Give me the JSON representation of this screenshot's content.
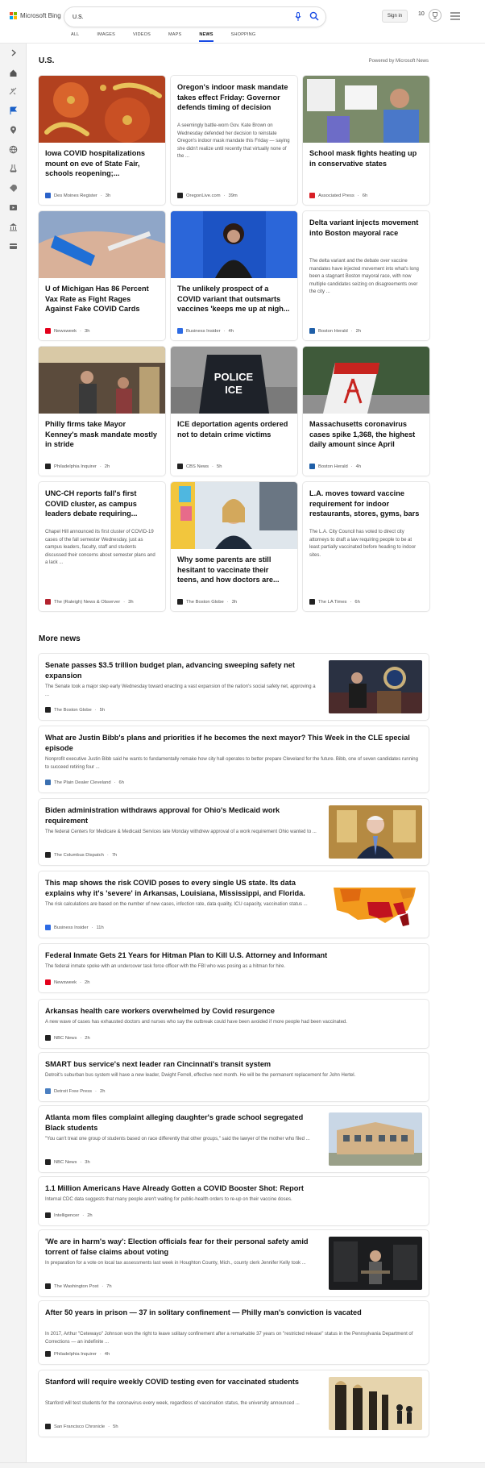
{
  "header": {
    "brand": "Microsoft Bing",
    "search_value": "U.S.",
    "signin_label": "Sign in",
    "points": "10",
    "tabs": [
      {
        "label": "ALL",
        "active": false
      },
      {
        "label": "IMAGES",
        "active": false
      },
      {
        "label": "VIDEOS",
        "active": false
      },
      {
        "label": "MAPS",
        "active": false
      },
      {
        "label": "NEWS",
        "active": true
      },
      {
        "label": "SHOPPING",
        "active": false
      }
    ]
  },
  "sidebar": {
    "icons": [
      "expand-icon",
      "home-icon",
      "discover-icon",
      "flag-icon",
      "location-pin-icon",
      "globe-icon",
      "science-icon",
      "rocket-icon",
      "entertainment-icon",
      "bank-icon",
      "card-icon"
    ]
  },
  "section": {
    "title": "U.S.",
    "powered_by": "Powered by Microsoft News"
  },
  "cards": [
    {
      "headline": "Iowa COVID hospitalizations mount on eve of State Fair, schools reopening;...",
      "snippet": "",
      "source": "Des Moines Register",
      "age": "3h",
      "image": "virus-image",
      "fav_color": "#2a62c9"
    },
    {
      "headline": "Oregon's indoor mask mandate takes effect Friday: Governor defends timing of decision",
      "snippet": "A seemingly battle-worn Gov. Kate Brown on Wednesday defended her decision to reinstate Oregon's indoor mask mandate this Friday — saying she didn't realize until recently that virtually none of the ...",
      "source": "OregonLive.com",
      "age": "39m",
      "image": "",
      "fav_color": "#222222"
    },
    {
      "headline": "School mask fights heating up in conservative states",
      "snippet": "",
      "source": "Associated Press",
      "age": "6h",
      "image": "protest-image",
      "fav_color": "#d81f26"
    },
    {
      "headline": "U of Michigan Has 86 Percent Vax Rate as Fight Rages Against Fake COVID Cards",
      "snippet": "",
      "source": "Newsweek",
      "age": "3h",
      "image": "vaccine-shot-image",
      "fav_color": "#e3001b"
    },
    {
      "headline": "The unlikely prospect of a COVID variant that outsmarts vaccines 'keeps me up at nigh...",
      "snippet": "",
      "source": "Business Insider",
      "age": "4h",
      "image": "press-briefing-image",
      "fav_color": "#2d6be4"
    },
    {
      "headline": "Delta variant injects movement into Boston mayoral race",
      "snippet": "The delta variant and the debate over vaccine mandates have injected movement into what's long been a stagnant Boston mayoral race, with now multiple candidates seizing on disagreements over the city ...",
      "source": "Boston Herald",
      "age": "2h",
      "image": "",
      "fav_color": "#1f5fa8"
    },
    {
      "headline": "Philly firms take Mayor Kenney's mask mandate mostly in stride",
      "snippet": "",
      "source": "Philadelphia Inquirer",
      "age": "2h",
      "image": "market-image",
      "fav_color": "#222222"
    },
    {
      "headline": "ICE deportation agents ordered not to detain crime victims",
      "snippet": "",
      "source": "CBS News",
      "age": "5h",
      "image": "police-ice-image",
      "fav_color": "#222222"
    },
    {
      "headline": "Massachusetts coronavirus cases spike 1,368, the highest daily amount since April",
      "snippet": "",
      "source": "Boston Herald",
      "age": "4h",
      "image": "vaccination-site-image",
      "fav_color": "#1f5fa8"
    },
    {
      "headline": "UNC-CH reports fall's first COVID cluster, as campus leaders debate requiring...",
      "snippet": "Chapel Hill announced its first cluster of COVID-19 cases of the fall semester Wednesday, just as campus leaders, faculty, staff and students discussed their concerns about semester plans and a lack ...",
      "source": "The (Raleigh) News & Observer",
      "age": "3h",
      "image": "",
      "fav_color": "#b3232e"
    },
    {
      "headline": "Why some parents are still hesitant to vaccinate their teens, and how doctors are...",
      "snippet": "",
      "source": "The Boston Globe",
      "age": "3h",
      "image": "doctor-image",
      "fav_color": "#222222"
    },
    {
      "headline": "L.A. moves toward vaccine requirement for indoor restaurants, stores, gyms, bars",
      "snippet": "The L.A. City Council has voted to direct city attorneys to draft a law requiring people to be at least partially vaccinated before heading to indoor sites.",
      "source": "The LA Times",
      "age": "6h",
      "image": "",
      "fav_color": "#222222"
    }
  ],
  "more_news": {
    "title": "More news",
    "items": [
      {
        "headline": "Senate passes $3.5 trillion budget plan, advancing sweeping safety net expansion",
        "snippet": "The Senate took a major step early Wednesday toward enacting a vast expansion of the nation's social safety net, approving a ...",
        "source": "The Boston Globe",
        "age": "5h",
        "thumb": "senate-image",
        "fav_color": "#222222"
      },
      {
        "headline": "What are Justin Bibb's plans and priorities if he becomes the next mayor? This Week in the CLE special episode",
        "snippet": "Nonprofit executive Justin Bibb said he wants to fundamentally remake how city hall operates to better prepare Cleveland for the future. Bibb, one of seven candidates running to succeed retiring four ...",
        "source": "The Plain Dealer Cleveland",
        "age": "6h",
        "thumb": "",
        "fav_color": "#3a6fb0"
      },
      {
        "headline": "Biden administration withdraws approval for Ohio's Medicaid work requirement",
        "snippet": "The federal Centers for Medicare & Medicaid Services late Monday withdrew approval of a work requirement Ohio wanted to ...",
        "source": "The Columbus Dispatch",
        "age": "7h",
        "thumb": "biden-image",
        "fav_color": "#222222"
      },
      {
        "headline": "This map shows the risk COVID poses to every single US state. Its data explains why it's 'severe' in Arkansas, Louisiana, Mississippi, and Florida.",
        "snippet": "The risk calculations are based on the number of new cases, infection rate, data quality, ICU capacity, vaccination status ...",
        "source": "Business Insider",
        "age": "11h",
        "thumb": "us-map-image",
        "fav_color": "#2d6be4"
      },
      {
        "headline": "Federal Inmate Gets 21 Years for Hitman Plan to Kill U.S. Attorney and Informant",
        "snippet": "The federal inmate spoke with an undercover task force officer with the FBI who was posing as a hitman for hire.",
        "source": "Newsweek",
        "age": "2h",
        "thumb": "",
        "fav_color": "#e3001b"
      },
      {
        "headline": "Arkansas health care workers overwhelmed by Covid resurgence",
        "snippet": "A new wave of cases has exhausted doctors and nurses who say the outbreak could have been avoided if more people had been vaccinated.",
        "source": "NBC News",
        "age": "2h",
        "thumb": "",
        "fav_color": "#222222"
      },
      {
        "headline": "SMART bus service's next leader ran Cincinnati's transit system",
        "snippet": "Detroit's suburban bus system will have a new leader, Dwight Ferrell, effective next month. He will be the permanent replacement for John Hertel.",
        "source": "Detroit Free Press",
        "age": "2h",
        "thumb": "",
        "fav_color": "#4a7fc1"
      },
      {
        "headline": "Atlanta mom files complaint alleging daughter's grade school segregated Black students",
        "snippet": "\"You can't treat one group of students based on race differently that other groups,\" said the lawyer of the mother who filed ...",
        "source": "NBC News",
        "age": "3h",
        "thumb": "school-image",
        "fav_color": "#222222"
      },
      {
        "headline": "1.1 Million Americans Have Already Gotten a COVID Booster Shot: Report",
        "snippet": "Internal CDC data suggests that many people aren't waiting for public-health orders to re-up on their vaccine doses.",
        "source": "Intelligencer",
        "age": "2h",
        "thumb": "",
        "fav_color": "#222222"
      },
      {
        "headline": "'We are in harm's way': Election officials fear for their personal safety amid torrent of false claims about voting",
        "snippet": "In preparation for a vote on local tax assessments last week in Houghton County, Mich., county clerk Jennifer Kelly took ...",
        "source": "The Washington Post",
        "age": "7h",
        "thumb": "office-image",
        "fav_color": "#222222"
      },
      {
        "headline": "After 50 years in prison — 37 in solitary confinement — Philly man's conviction is vacated",
        "snippet": "In 2017, Arthur \"Cetewayo\" Johnson won the right to leave solitary confinement after a remarkable 37 years on \"restricted release\" status in the Pennsylvania Department of Corrections — an indefinite ...",
        "source": "Philadelphia Inquirer",
        "age": "4h",
        "thumb": "",
        "fav_color": "#222222"
      },
      {
        "headline": "Stanford will require weekly COVID testing even for vaccinated students",
        "snippet": "Stanford will test students for the coronavirus every week, regardless of vaccination status, the university announced ...",
        "source": "San Francisco Chronicle",
        "age": "5h",
        "thumb": "arcade-image",
        "fav_color": "#222222"
      }
    ]
  }
}
